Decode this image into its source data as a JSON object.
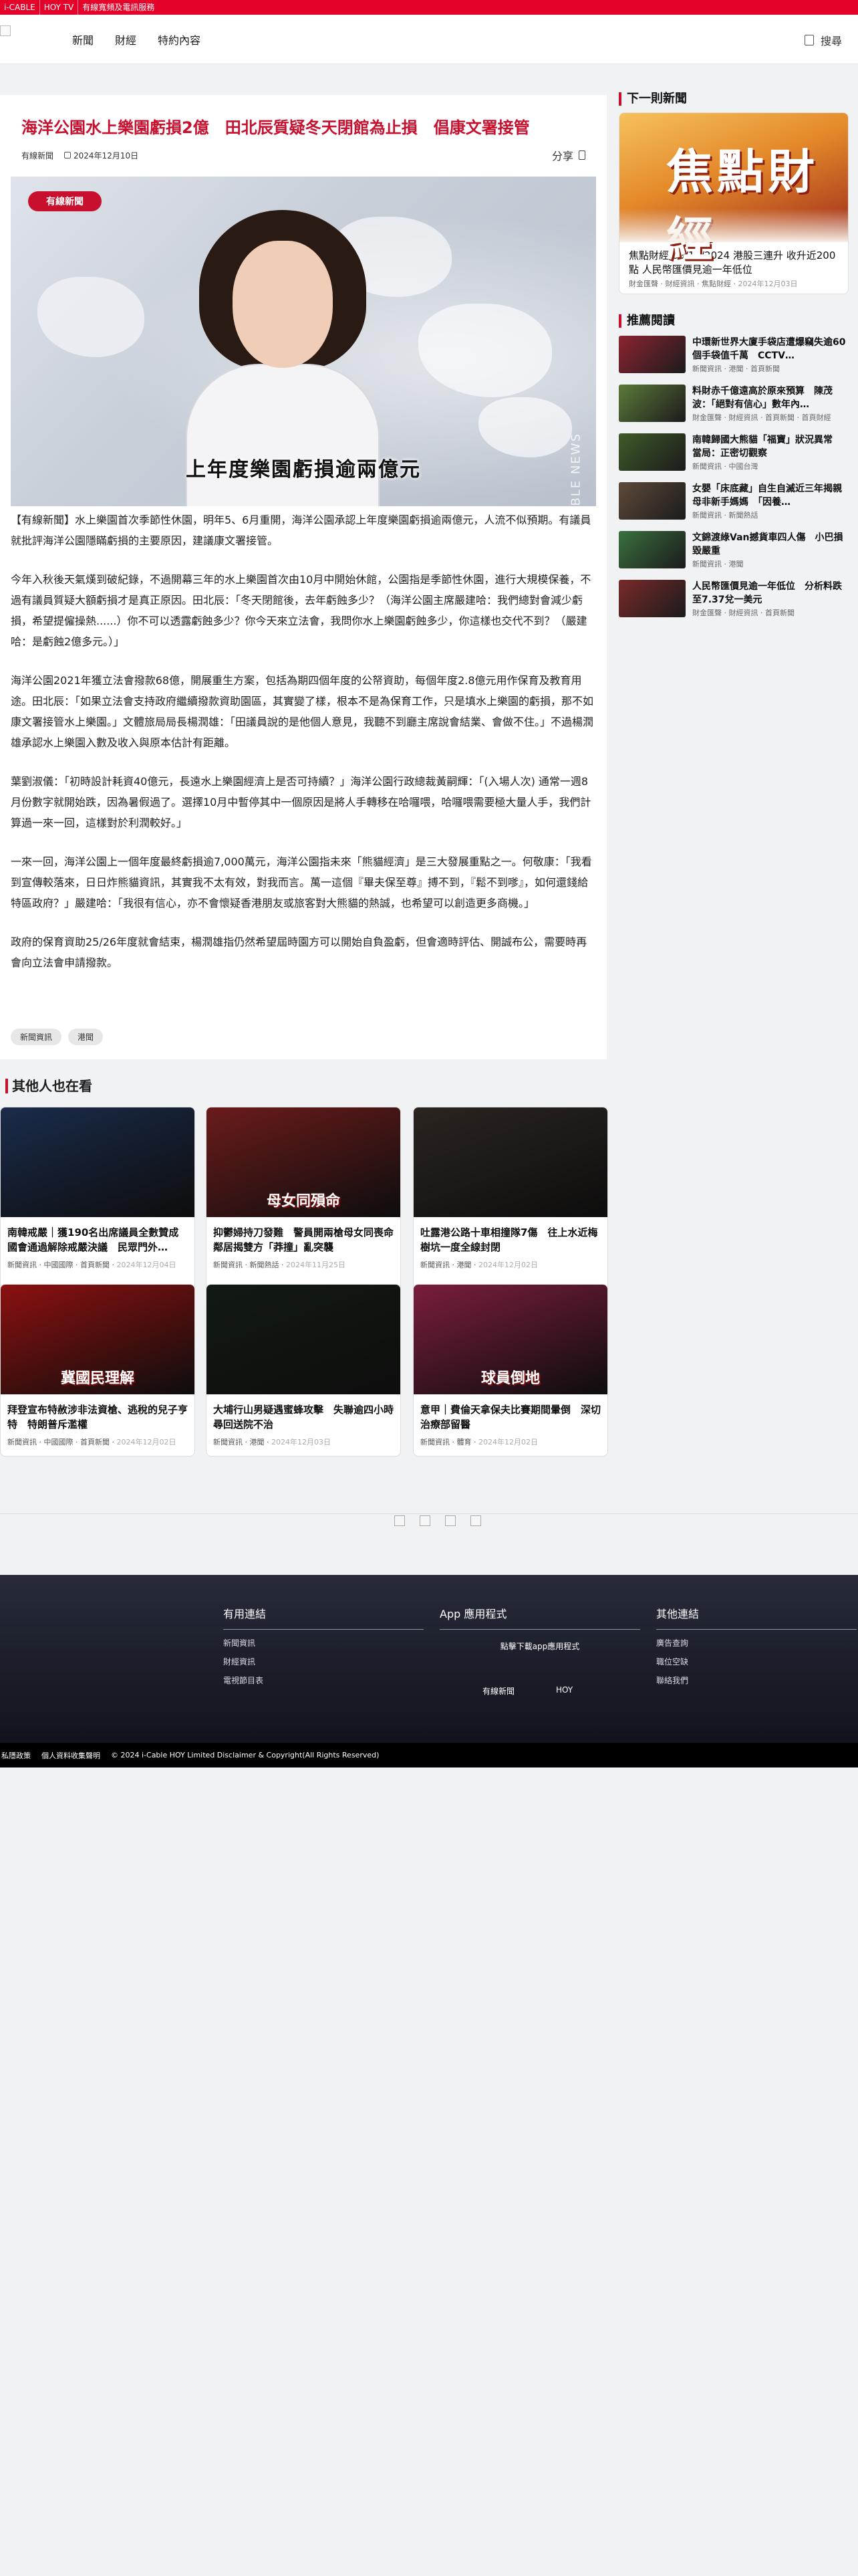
{
  "topbar": {
    "items": [
      "i-CABLE",
      "HOY TV",
      "有線寬頻及電訊服務"
    ]
  },
  "nav": {
    "menu": [
      "新聞",
      "財經",
      "特約內容"
    ],
    "search_label": "搜尋"
  },
  "article": {
    "title": "海洋公園水上樂園虧損2億　田北辰質疑冬天閉館為止損　倡康文署接管",
    "source": "有線新聞",
    "date": "2024年12月10日",
    "share_label": "分享",
    "video": {
      "channel_logo": "有線新聞",
      "caption": "上年度樂園虧損逾兩億元",
      "watermark": "CABLE NEWS"
    },
    "paragraphs": [
      "【有線新聞】水上樂園首次季節性休園，明年5、6月重開，海洋公園承認上年度樂園虧損逾兩億元，人流不似預期。有議員就批評海洋公園隱瞞虧損的主要原因，建議康文署接管。",
      "今年入秋後天氣熯到破紀錄，不過開幕三年的水上樂園首次由10月中開始休館，公園指是季節性休園，進行大規模保養，不過有議員質疑大額虧損才是真正原因。田北辰：「冬天閉館後，去年虧蝕多少？（海洋公園主席嚴建哈：我們總對會減少虧損，希望提僱操熱......）你不可以透露虧蝕多少？你今天來立法會，我問你水上樂園虧蝕多少，你這樣也交代不到？（嚴建哈：是虧蝕2億多元。）」",
      "海洋公園2021年獲立法會撥款68億，開展重生方案，包括為期四個年度的公帑資助，每個年度2.8億元用作保育及教育用途。田北辰：「如果立法會支持政府繼續撥款資助園區，其實變了樣，根本不是為保育工作，只是填水上樂園的虧損，那不如康文署接管水上樂園。」文體旅局局長楊潤雄：「田議員說的是他個人意見，我聽不到廳主席說會結業、會做不住。」不過楊潤雄承認水上樂園入數及收入與原本估計有距離。",
      "葉劉淑儀：「初時設計耗資40億元，長遠水上樂園經濟上是否可持續？」海洋公園行政總裁黃嗣輝：「(入場人次) 通常一週8月份數字就開始跌，因為暑假過了。選擇10月中暫停其中一個原因是將人手轉移在哈囉喂，哈囉喂需要極大量人手，我們計算過一來一回，這樣對於利潤較好。」",
      "一來一回，海洋公園上一個年度最終虧損逾7,000萬元，海洋公園指未來「熊貓經濟」是三大發展重點之一。何敬康：「我看到宣傳較落來，日日炸熊貓資訊，其實我不太有效，對我而言。萬一這個『畢夫保至尊』搏不到，『鬆不到嗲』，如何還錢給特區政府？」嚴建哈：「我很有信心，亦不會懷疑香港朋友或旅客對大熊貓的熱誠，也希望可以創造更多商機。」",
      "政府的保育資助25/26年度就會結束，楊潤雄指仍然希望屆時園方可以開始自負盈虧，但會適時評估、開誠布公，需要時再會向立法會申請撥款。"
    ],
    "tags": [
      "新聞資訊",
      "港聞"
    ]
  },
  "sidebar": {
    "next_heading": "下一則新聞",
    "next": {
      "image_text": "焦點財經",
      "title": "焦點財經 03/12/2024 港股三連升 收升近200點 人民幣匯價見逾一年低位",
      "cats": [
        "財金匯聲",
        "財經資訊",
        "焦點財經"
      ],
      "date": "2024年12月03日"
    },
    "rec_heading": "推薦閱讀",
    "rec": [
      {
        "title": "中環新世界大廈手袋店遭爆竊失逾60個手袋值千萬　CCTV…",
        "meta": "新聞資訊 · 港聞 · 首頁新聞",
        "color": "#8d2432"
      },
      {
        "title": "料財赤千億遠高於原來預算　陳茂波：「絕對有信心」數年內…",
        "meta": "財金匯聲 · 財經資訊 · 首頁新聞 · 首頁財經",
        "color": "#5b7a3a"
      },
      {
        "title": "南韓歸國大熊貓「福寶」狀況異常　當局：正密切觀察",
        "meta": "新聞資訊 · 中國台灣",
        "color": "#3f5b2a"
      },
      {
        "title": "女嬰「床底藏」自生自滅近三年揭親母非新手媽媽　「因養…",
        "meta": "新聞資訊 · 新聞熱話",
        "color": "#5e4a3a"
      },
      {
        "title": "文錦渡綠Van撼貨車四人傷　小巴損毀嚴重",
        "meta": "新聞資訊 · 港聞",
        "color": "#39703e"
      },
      {
        "title": "人民幣匯價見逾一年低位　分析料跌至7.37兌一美元",
        "meta": "財金匯聲 · 財經資訊 · 首頁新聞",
        "color": "#7a2a2a"
      }
    ]
  },
  "others": {
    "heading": "其他人也在看",
    "cards": [
      {
        "title": "南韓戒嚴｜獲190名出席議員全數贊成國會通過解除戒嚴決議　民眾門外…",
        "cats": "新聞資訊 · 中國國際 · 首頁新聞",
        "date": "2024年12月04日",
        "color": "#1a2b4a",
        "label": ""
      },
      {
        "title": "抑鬱婦持刀發難　警員開兩槍母女同喪命　鄰居揭雙方「莽撞」亂突襲",
        "cats": "新聞資訊 · 新聞熱話",
        "date": "2024年11月25日",
        "color": "#6b1b1b",
        "label": "母女同殞命"
      },
      {
        "title": "吐露港公路十車相撞隊7傷　往上水近梅樹坑一度全線封閉",
        "cats": "新聞資訊 · 港聞",
        "date": "2024年12月02日",
        "color": "#2b2420",
        "label": ""
      },
      {
        "title": "拜登宣布特赦涉非法資槍、逃稅的兒子亨特　特朗普斥濫權",
        "cats": "新聞資訊 · 中國國際 · 首頁新聞",
        "date": "2024年12月02日",
        "color": "#8c1010",
        "label": "冀國民理解"
      },
      {
        "title": "大埔行山男疑遇蜜蜂攻擊　失聯逾四小時尋回送院不治",
        "cats": "新聞資訊 · 港聞",
        "date": "2024年12月03日",
        "color": "#121a12",
        "label": ""
      },
      {
        "title": "意甲｜費倫天拿保夫比賽期間暈倒　深切治療部留醫",
        "cats": "新聞資訊 · 體育",
        "date": "2024年12月02日",
        "color": "#7a1d3c",
        "label": "球員倒地"
      }
    ]
  },
  "footer": {
    "col1_title": "有用連結",
    "col1_links": [
      "新聞資訊",
      "財經資訊",
      "電視節目表"
    ],
    "col2_title": "App 應用程式",
    "col2_text": "點擊下載app應用程式",
    "col2_apps": [
      "有線新聞",
      "HOY"
    ],
    "col3_title": "其他連結",
    "col3_links": [
      "廣告查詢",
      "職位空缺",
      "聯絡我們"
    ]
  },
  "bottom": {
    "items": [
      "私隱政策",
      "個人資料收集聲明",
      "© 2024 i-Cable HOY Limited Disclaimer & Copyright(All Rights Reserved)"
    ]
  }
}
